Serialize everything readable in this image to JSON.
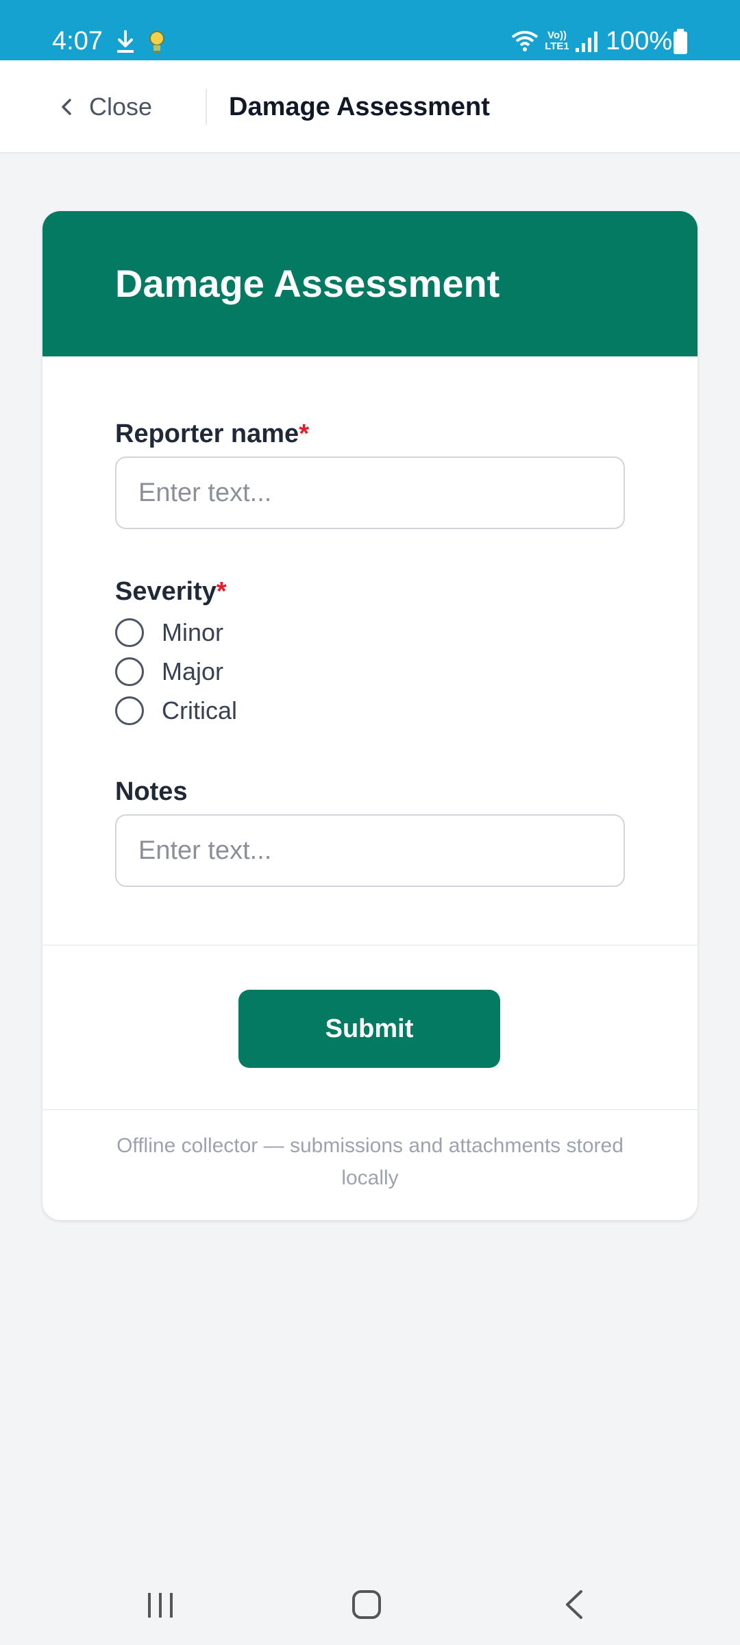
{
  "status_bar": {
    "time": "4:07",
    "volte": "Vo))\nLTE1",
    "battery": "100%",
    "icons": [
      "download-icon",
      "bulb-icon",
      "wifi-icon",
      "signal-icon",
      "battery-icon"
    ]
  },
  "app_bar": {
    "close_label": "Close",
    "title": "Damage Assessment"
  },
  "form": {
    "title": "Damage Assessment",
    "fields": {
      "reporter": {
        "label": "Reporter name",
        "required_mark": "*",
        "placeholder": "Enter text..."
      },
      "severity": {
        "label": "Severity",
        "required_mark": "*",
        "options": [
          "Minor",
          "Major",
          "Critical"
        ]
      },
      "notes": {
        "label": "Notes",
        "placeholder": "Enter text..."
      }
    },
    "submit_label": "Submit",
    "footer_note": "Offline collector — submissions and attachments stored locally"
  },
  "colors": {
    "status_bar": "#16a2d1",
    "accent": "#037a61",
    "required": "#e11d2e",
    "background": "#f3f4f6"
  }
}
